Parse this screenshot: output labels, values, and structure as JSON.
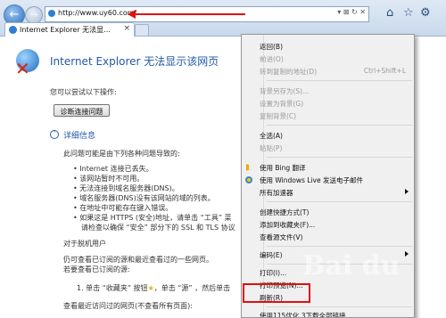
{
  "browser": {
    "address_url": "http://www.uy60.com/",
    "address_tools": "▾ ⊠ ↻ ✕",
    "tab_title": "Internet Explorer 无法显..."
  },
  "page": {
    "title": "Internet Explorer 无法显示该网页",
    "try_text": "您可以尝试以下操作:",
    "diagnose_button": "诊断连接问题",
    "more_info": "详细信息",
    "cause_intro": "此问题可能是由下列各种问题导致的:",
    "bullets": [
      "Internet 连接已丢失。",
      "该网站暂时不可用。",
      "无法连接到域名服务器(DNS)。",
      "域名服务器(DNS)没有该网站的域的列表。",
      "在地址中可能存在键入错误。",
      "如果这是 HTTPS (安全)地址，请单击 “工具” 菜",
      "请检查以确保 “安全” 部分下的 SSL 和 TLS 协议"
    ],
    "offline_heading": "对于脱机用户",
    "offline_line1": "仍可查看已订阅的源和最近查看过的一些网页。",
    "offline_line2": "若要查看已订阅的源:",
    "step1_a": "1. 单击 “收藏夹” 按钮",
    "step1_b": "，单击 “源” ，然后单击",
    "recent_view": "查看最近访问过的网页(不查看所有页面):"
  },
  "context_menu": {
    "items": [
      {
        "label": "返回(B)",
        "disabled": false
      },
      {
        "label": "前进(O)",
        "disabled": true
      },
      {
        "label": "转到复制的地址(D)",
        "shortcut": "Ctrl+Shift+L",
        "disabled": true
      },
      {
        "label": "背景另存为(S)...",
        "disabled": true
      },
      {
        "label": "设置为背景(G)",
        "disabled": true
      },
      {
        "label": "复制背景(C)",
        "disabled": true
      },
      {
        "label": "全选(A)",
        "disabled": false
      },
      {
        "label": "粘贴(P)",
        "disabled": true
      },
      {
        "label": "使用 Bing 翻译",
        "disabled": false
      },
      {
        "label": "使用 Windows Live 发送电子邮件",
        "disabled": false
      },
      {
        "label": "所有加速器",
        "disabled": false
      },
      {
        "label": "创建快捷方式(T)",
        "disabled": false
      },
      {
        "label": "添加到收藏夹(F)...",
        "disabled": false
      },
      {
        "label": "查看源文件(V)",
        "disabled": false
      },
      {
        "label": "编码(E)",
        "disabled": false
      },
      {
        "label": "打印(I)...",
        "disabled": false
      },
      {
        "label": "打印预览(N)...",
        "disabled": false
      },
      {
        "label": "刷新(R)",
        "disabled": false
      },
      {
        "label": "使用115优化 3下载全部链接",
        "disabled": false
      }
    ]
  },
  "watermark": "Bai du",
  "colors": {
    "accent_blue": "#2359a5",
    "highlight_red": "#e01010"
  }
}
